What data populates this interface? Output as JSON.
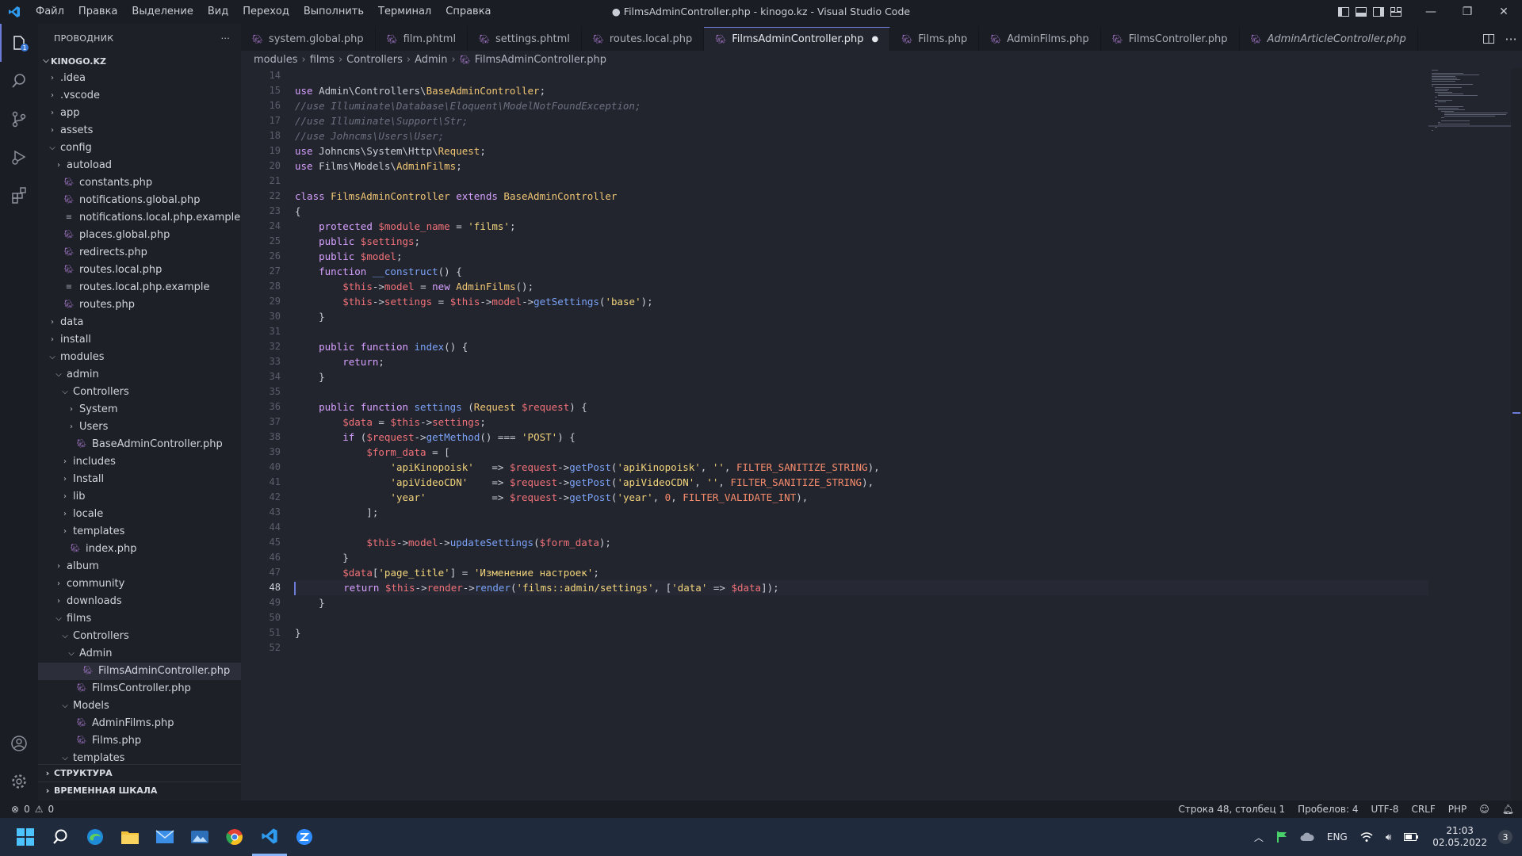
{
  "window": {
    "title": "● FilmsAdminController.php - kinogo.kz - Visual Studio Code",
    "menu": [
      "Файл",
      "Правка",
      "Выделение",
      "Вид",
      "Переход",
      "Выполнить",
      "Терминал",
      "Справка"
    ]
  },
  "explorer": {
    "header": "ПРОВОДНИК",
    "more": "···",
    "root": "KINOGO.KZ",
    "items": [
      {
        "label": ".idea",
        "depth": 1,
        "type": "folder",
        "open": false
      },
      {
        "label": ".vscode",
        "depth": 1,
        "type": "folder",
        "open": false
      },
      {
        "label": "app",
        "depth": 1,
        "type": "folder",
        "open": false
      },
      {
        "label": "assets",
        "depth": 1,
        "type": "folder",
        "open": false
      },
      {
        "label": "config",
        "depth": 1,
        "type": "folder",
        "open": true
      },
      {
        "label": "autoload",
        "depth": 2,
        "type": "folder",
        "open": false
      },
      {
        "label": "constants.php",
        "depth": 2,
        "type": "php"
      },
      {
        "label": "notifications.global.php",
        "depth": 2,
        "type": "php"
      },
      {
        "label": "notifications.local.php.example",
        "depth": 2,
        "type": "txt"
      },
      {
        "label": "places.global.php",
        "depth": 2,
        "type": "php"
      },
      {
        "label": "redirects.php",
        "depth": 2,
        "type": "php"
      },
      {
        "label": "routes.local.php",
        "depth": 2,
        "type": "php"
      },
      {
        "label": "routes.local.php.example",
        "depth": 2,
        "type": "txt"
      },
      {
        "label": "routes.php",
        "depth": 2,
        "type": "php"
      },
      {
        "label": "data",
        "depth": 1,
        "type": "folder",
        "open": false
      },
      {
        "label": "install",
        "depth": 1,
        "type": "folder",
        "open": false
      },
      {
        "label": "modules",
        "depth": 1,
        "type": "folder",
        "open": true
      },
      {
        "label": "admin",
        "depth": 2,
        "type": "folder",
        "open": true
      },
      {
        "label": "Controllers",
        "depth": 3,
        "type": "folder",
        "open": true
      },
      {
        "label": "System",
        "depth": 4,
        "type": "folder",
        "open": false
      },
      {
        "label": "Users",
        "depth": 4,
        "type": "folder",
        "open": false
      },
      {
        "label": "BaseAdminController.php",
        "depth": 4,
        "type": "php"
      },
      {
        "label": "includes",
        "depth": 3,
        "type": "folder",
        "open": false
      },
      {
        "label": "Install",
        "depth": 3,
        "type": "folder",
        "open": false
      },
      {
        "label": "lib",
        "depth": 3,
        "type": "folder",
        "open": false
      },
      {
        "label": "locale",
        "depth": 3,
        "type": "folder",
        "open": false
      },
      {
        "label": "templates",
        "depth": 3,
        "type": "folder",
        "open": false
      },
      {
        "label": "index.php",
        "depth": 3,
        "type": "php"
      },
      {
        "label": "album",
        "depth": 2,
        "type": "folder",
        "open": false
      },
      {
        "label": "community",
        "depth": 2,
        "type": "folder",
        "open": false
      },
      {
        "label": "downloads",
        "depth": 2,
        "type": "folder",
        "open": false
      },
      {
        "label": "films",
        "depth": 2,
        "type": "folder",
        "open": true
      },
      {
        "label": "Controllers",
        "depth": 3,
        "type": "folder",
        "open": true
      },
      {
        "label": "Admin",
        "depth": 4,
        "type": "folder",
        "open": true
      },
      {
        "label": "FilmsAdminController.php",
        "depth": 5,
        "type": "php",
        "selected": true
      },
      {
        "label": "FilmsController.php",
        "depth": 4,
        "type": "php"
      },
      {
        "label": "Models",
        "depth": 3,
        "type": "folder",
        "open": true
      },
      {
        "label": "AdminFilms.php",
        "depth": 4,
        "type": "php"
      },
      {
        "label": "Films.php",
        "depth": 4,
        "type": "php"
      },
      {
        "label": "templates",
        "depth": 3,
        "type": "folder",
        "open": true
      }
    ],
    "outline": "СТРУКТУРА",
    "timeline": "ВРЕМЕННАЯ ШКАЛА"
  },
  "tabs": [
    {
      "label": "system.global.php",
      "active": false,
      "italic": false
    },
    {
      "label": "film.phtml",
      "active": false,
      "italic": false
    },
    {
      "label": "settings.phtml",
      "active": false,
      "italic": false
    },
    {
      "label": "routes.local.php",
      "active": false,
      "italic": false
    },
    {
      "label": "FilmsAdminController.php",
      "active": true,
      "italic": false,
      "dirty": "●"
    },
    {
      "label": "Films.php",
      "active": false,
      "italic": false
    },
    {
      "label": "AdminFilms.php",
      "active": false,
      "italic": false
    },
    {
      "label": "FilmsController.php",
      "active": false,
      "italic": false
    },
    {
      "label": "AdminArticleController.php",
      "active": false,
      "italic": true
    }
  ],
  "breadcrumb": [
    "modules",
    "films",
    "Controllers",
    "Admin",
    "FilmsAdminController.php"
  ],
  "editor": {
    "first_line": 14,
    "current_line": 48,
    "lines": [
      [],
      [
        [
          "k",
          "use "
        ],
        [
          "pun",
          "Admin\\Controllers\\"
        ],
        [
          "cls",
          "BaseAdminController"
        ],
        [
          "pun",
          ";"
        ]
      ],
      [
        [
          "cm",
          "//use Illuminate\\Database\\Eloquent\\ModelNotFoundException;"
        ]
      ],
      [
        [
          "cm",
          "//use Illuminate\\Support\\Str;"
        ]
      ],
      [
        [
          "cm",
          "//use Johncms\\Users\\User;"
        ]
      ],
      [
        [
          "k",
          "use "
        ],
        [
          "pun",
          "Johncms\\System\\Http\\"
        ],
        [
          "cls",
          "Request"
        ],
        [
          "pun",
          ";"
        ]
      ],
      [
        [
          "k",
          "use "
        ],
        [
          "pun",
          "Films\\Models\\"
        ],
        [
          "cls",
          "AdminFilms"
        ],
        [
          "pun",
          ";"
        ]
      ],
      [],
      [
        [
          "k",
          "class "
        ],
        [
          "cls",
          "FilmsAdminController "
        ],
        [
          "k",
          "extends "
        ],
        [
          "cls",
          "BaseAdminController"
        ]
      ],
      [
        [
          "pun",
          "{"
        ]
      ],
      [
        [
          "pun",
          "    "
        ],
        [
          "k",
          "protected "
        ],
        [
          "var",
          "$module_name"
        ],
        [
          "pun",
          " = "
        ],
        [
          "str",
          "'films'"
        ],
        [
          "pun",
          ";"
        ]
      ],
      [
        [
          "pun",
          "    "
        ],
        [
          "k",
          "public "
        ],
        [
          "var",
          "$settings"
        ],
        [
          "pun",
          ";"
        ]
      ],
      [
        [
          "pun",
          "    "
        ],
        [
          "k",
          "public "
        ],
        [
          "var",
          "$model"
        ],
        [
          "pun",
          ";"
        ]
      ],
      [
        [
          "pun",
          "    "
        ],
        [
          "k",
          "function "
        ],
        [
          "fn",
          "__construct"
        ],
        [
          "pun",
          "() {"
        ]
      ],
      [
        [
          "pun",
          "        "
        ],
        [
          "var",
          "$this"
        ],
        [
          "pun",
          "->"
        ],
        [
          "var",
          "model"
        ],
        [
          "pun",
          " = "
        ],
        [
          "k",
          "new "
        ],
        [
          "cls",
          "AdminFilms"
        ],
        [
          "pun",
          "();"
        ]
      ],
      [
        [
          "pun",
          "        "
        ],
        [
          "var",
          "$this"
        ],
        [
          "pun",
          "->"
        ],
        [
          "var",
          "settings"
        ],
        [
          "pun",
          " = "
        ],
        [
          "var",
          "$this"
        ],
        [
          "pun",
          "->"
        ],
        [
          "var",
          "model"
        ],
        [
          "pun",
          "->"
        ],
        [
          "fn",
          "getSettings"
        ],
        [
          "pun",
          "("
        ],
        [
          "str",
          "'base'"
        ],
        [
          "pun",
          ");"
        ]
      ],
      [
        [
          "pun",
          "    }"
        ]
      ],
      [],
      [
        [
          "pun",
          "    "
        ],
        [
          "k",
          "public function "
        ],
        [
          "fn",
          "index"
        ],
        [
          "pun",
          "() {"
        ]
      ],
      [
        [
          "pun",
          "        "
        ],
        [
          "k",
          "return"
        ],
        [
          "pun",
          ";"
        ]
      ],
      [
        [
          "pun",
          "    }"
        ]
      ],
      [],
      [
        [
          "pun",
          "    "
        ],
        [
          "k",
          "public function "
        ],
        [
          "fn",
          "settings "
        ],
        [
          "pun",
          "("
        ],
        [
          "cls",
          "Request "
        ],
        [
          "var",
          "$request"
        ],
        [
          "pun",
          ") {"
        ]
      ],
      [
        [
          "pun",
          "        "
        ],
        [
          "var",
          "$data"
        ],
        [
          "pun",
          " = "
        ],
        [
          "var",
          "$this"
        ],
        [
          "pun",
          "->"
        ],
        [
          "var",
          "settings"
        ],
        [
          "pun",
          ";"
        ]
      ],
      [
        [
          "pun",
          "        "
        ],
        [
          "k",
          "if "
        ],
        [
          "pun",
          "("
        ],
        [
          "var",
          "$request"
        ],
        [
          "pun",
          "->"
        ],
        [
          "fn",
          "getMethod"
        ],
        [
          "pun",
          "() === "
        ],
        [
          "str",
          "'POST'"
        ],
        [
          "pun",
          ") {"
        ]
      ],
      [
        [
          "pun",
          "            "
        ],
        [
          "var",
          "$form_data"
        ],
        [
          "pun",
          " = ["
        ]
      ],
      [
        [
          "pun",
          "                "
        ],
        [
          "str",
          "'apiKinopoisk'"
        ],
        [
          "pun",
          "   => "
        ],
        [
          "var",
          "$request"
        ],
        [
          "pun",
          "->"
        ],
        [
          "fn",
          "getPost"
        ],
        [
          "pun",
          "("
        ],
        [
          "str",
          "'apiKinopoisk'"
        ],
        [
          "pun",
          ", "
        ],
        [
          "str",
          "''"
        ],
        [
          "pun",
          ", "
        ],
        [
          "cst",
          "FILTER_SANITIZE_STRING"
        ],
        [
          "pun",
          "),"
        ]
      ],
      [
        [
          "pun",
          "                "
        ],
        [
          "str",
          "'apiVideoCDN'"
        ],
        [
          "pun",
          "    => "
        ],
        [
          "var",
          "$request"
        ],
        [
          "pun",
          "->"
        ],
        [
          "fn",
          "getPost"
        ],
        [
          "pun",
          "("
        ],
        [
          "str",
          "'apiVideoCDN'"
        ],
        [
          "pun",
          ", "
        ],
        [
          "str",
          "''"
        ],
        [
          "pun",
          ", "
        ],
        [
          "cst",
          "FILTER_SANITIZE_STRING"
        ],
        [
          "pun",
          "),"
        ]
      ],
      [
        [
          "pun",
          "                "
        ],
        [
          "str",
          "'year'"
        ],
        [
          "pun",
          "           => "
        ],
        [
          "var",
          "$request"
        ],
        [
          "pun",
          "->"
        ],
        [
          "fn",
          "getPost"
        ],
        [
          "pun",
          "("
        ],
        [
          "str",
          "'year'"
        ],
        [
          "pun",
          ", "
        ],
        [
          "cst",
          "0"
        ],
        [
          "pun",
          ", "
        ],
        [
          "cst",
          "FILTER_VALIDATE_INT"
        ],
        [
          "pun",
          "),"
        ]
      ],
      [
        [
          "pun",
          "            ];"
        ]
      ],
      [],
      [
        [
          "pun",
          "            "
        ],
        [
          "var",
          "$this"
        ],
        [
          "pun",
          "->"
        ],
        [
          "var",
          "model"
        ],
        [
          "pun",
          "->"
        ],
        [
          "fn",
          "updateSettings"
        ],
        [
          "pun",
          "("
        ],
        [
          "var",
          "$form_data"
        ],
        [
          "pun",
          ");"
        ]
      ],
      [
        [
          "pun",
          "        }"
        ]
      ],
      [
        [
          "pun",
          "        "
        ],
        [
          "var",
          "$data"
        ],
        [
          "pun",
          "["
        ],
        [
          "str",
          "'page_title'"
        ],
        [
          "pun",
          "] = "
        ],
        [
          "str",
          "'Изменение настроек'"
        ],
        [
          "pun",
          ";"
        ]
      ],
      [
        [
          "pun",
          "        "
        ],
        [
          "k",
          "return "
        ],
        [
          "var",
          "$this"
        ],
        [
          "pun",
          "->"
        ],
        [
          "var",
          "render"
        ],
        [
          "pun",
          "->"
        ],
        [
          "fn",
          "render"
        ],
        [
          "pun",
          "("
        ],
        [
          "str",
          "'films::admin/settings'"
        ],
        [
          "pun",
          ", ["
        ],
        [
          "str",
          "'data'"
        ],
        [
          "pun",
          " => "
        ],
        [
          "var",
          "$data"
        ],
        [
          "pun",
          "]);"
        ]
      ],
      [
        [
          "pun",
          "    }"
        ]
      ],
      [],
      [
        [
          "pun",
          "}"
        ]
      ],
      []
    ]
  },
  "status": {
    "errors": "0",
    "warnings": "0",
    "position": "Строка 48, столбец 1",
    "spaces": "Пробелов: 4",
    "encoding": "UTF-8",
    "eol": "CRLF",
    "language": "PHP"
  },
  "taskbar": {
    "lang": "ENG",
    "time": "21:03",
    "date": "02.05.2022",
    "notifications": "3"
  },
  "colors": {
    "accent": "#6b7bd6",
    "php_icon": "#a074c4"
  }
}
